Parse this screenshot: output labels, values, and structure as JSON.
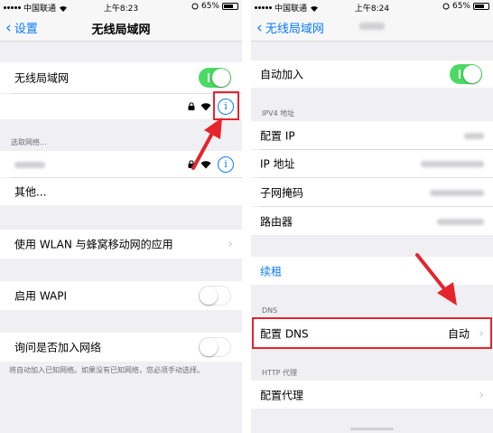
{
  "left": {
    "status": {
      "carrier": "中国联通",
      "time": "上午8:23",
      "battery": "65%",
      "battery_level": 0.65
    },
    "nav": {
      "back_label": "设置",
      "title": "无线局域网"
    },
    "wlan": {
      "label": "无线局域网",
      "toggle_on": true
    },
    "choose_header": "选取网络...",
    "other_label": "其他...",
    "apps": {
      "label": "使用 WLAN 与蜂窝移动网的应用"
    },
    "wapi": {
      "label": "启用 WAPI",
      "toggle_on": false
    },
    "ask": {
      "label": "询问是否加入网络",
      "toggle_on": false,
      "note": "将自动加入已知网络。如果没有已知网络，您必须手动选择。"
    },
    "info_glyph": "i"
  },
  "right": {
    "status": {
      "carrier": "中国联通",
      "time": "上午8:24",
      "battery": "65%",
      "battery_level": 0.65
    },
    "nav": {
      "back_label": "无线局域网"
    },
    "auto_join": {
      "label": "自动加入",
      "toggle_on": true
    },
    "ipv4_header": "IPV4 地址",
    "ipv4_rows": [
      {
        "label": "配置 IP"
      },
      {
        "label": "IP 地址"
      },
      {
        "label": "子网掩码"
      },
      {
        "label": "路由器"
      }
    ],
    "renew_label": "续租",
    "dns_header": "DNS",
    "dns": {
      "label": "配置 DNS",
      "value": "自动"
    },
    "proxy_header": "HTTP 代理",
    "proxy": {
      "label": "配置代理"
    }
  },
  "colors": {
    "ios_blue": "#0a7aff",
    "switch_green": "#4cd964",
    "highlight_red": "#e5242b",
    "group_bg": "#efeff4"
  }
}
